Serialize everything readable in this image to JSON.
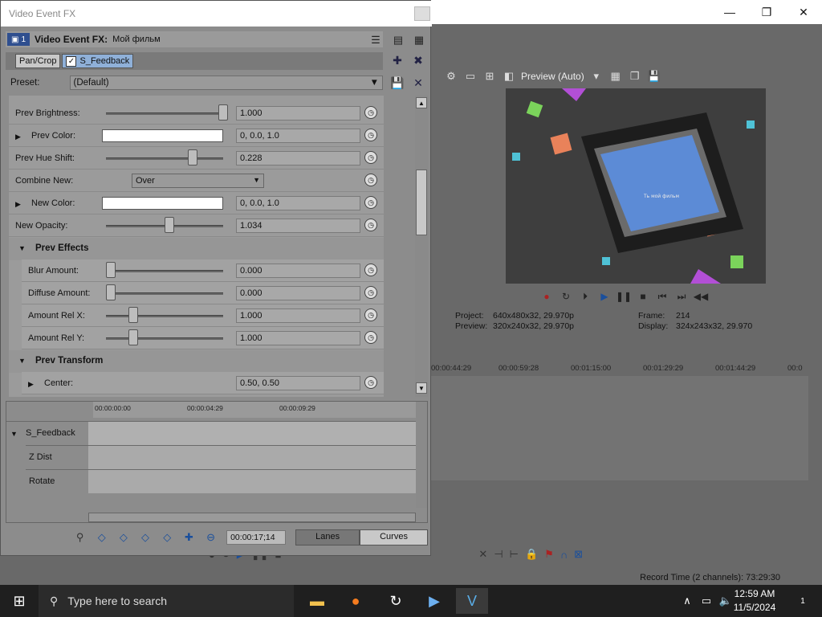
{
  "main_window": {
    "controls": {
      "minimize": "—",
      "maximize": "❐",
      "close": "✕"
    }
  },
  "preview": {
    "toolbar_label": "Preview (Auto)",
    "video_text": "Ть мой фильм",
    "info": {
      "project_label": "Project:",
      "project": "640x480x32, 29.970p",
      "preview_label": "Preview:",
      "preview": "320x240x32, 29.970p",
      "frame_label": "Frame:",
      "frame": "214",
      "display_label": "Display:",
      "display": "324x243x32, 29.970"
    }
  },
  "timeline": {
    "ticks": [
      "00:00:44:29",
      "00:00:59:28",
      "00:01:15:00",
      "00:01:29:29",
      "00:01:44:29",
      "00:0"
    ]
  },
  "status": {
    "record_time": "Record Time (2 channels): 73:29:30"
  },
  "fx": {
    "title": "Video Event FX",
    "header_badge": "1",
    "header_title": "Video Event FX:",
    "header_name": "Мой фильм",
    "chain": {
      "pan_crop": "Pan/Crop",
      "feedback": "S_Feedback",
      "check": "✓"
    },
    "preset_label": "Preset:",
    "preset_value": "(Default)",
    "params": [
      {
        "label": "Prev Brightness:",
        "value": "1.000"
      },
      {
        "label": "Prev Color:",
        "value": "0, 0.0, 1.0"
      },
      {
        "label": "Prev Hue Shift:",
        "value": "0.228"
      },
      {
        "label": "Combine New:",
        "combo": "Over"
      },
      {
        "label": "New Color:",
        "value": "0, 0.0, 1.0"
      },
      {
        "label": "New Opacity:",
        "value": "1.034"
      },
      {
        "group": "Prev Effects"
      },
      {
        "label": "Blur Amount:",
        "value": "0.000"
      },
      {
        "label": "Diffuse Amount:",
        "value": "0.000"
      },
      {
        "label": "Amount Rel X:",
        "value": "1.000"
      },
      {
        "label": "Amount Rel Y:",
        "value": "1.000"
      },
      {
        "group": "Prev Transform"
      },
      {
        "label": "Center:",
        "value": "0.50, 0.50"
      }
    ],
    "sliders": {
      "prev_brightness": 1.0,
      "prev_hue_shift": 0.73,
      "new_opacity": 0.52,
      "blur_amount": 0.0,
      "diffuse_amount": 0.0,
      "amount_rel_x": 0.2,
      "amount_rel_y": 0.2
    },
    "keyframes": {
      "ruler": [
        "00:00:00:00",
        "00:00:04:29",
        "00:00:09:29"
      ],
      "rows": [
        "S_Feedback",
        "Z Dist",
        "Rotate"
      ]
    },
    "bottom": {
      "time": "00:00:17;14",
      "lanes": "Lanes",
      "curves": "Curves"
    }
  },
  "taskbar": {
    "search_placeholder": "Type here to search",
    "time": "12:59 AM",
    "date": "11/5/2024",
    "notifications": "1"
  }
}
